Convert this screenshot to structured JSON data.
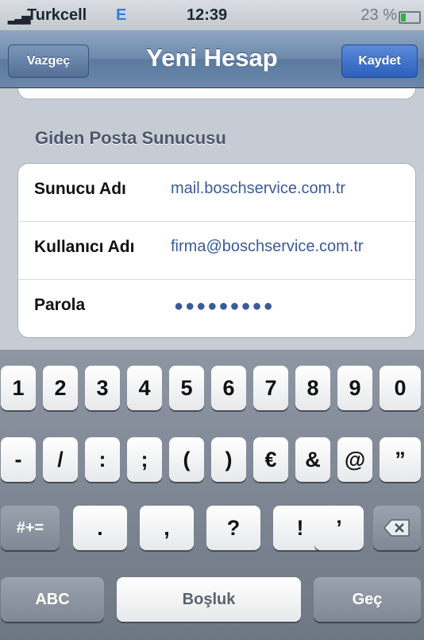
{
  "status": {
    "carrier": "Turkcell",
    "network": "E",
    "time": "12:39",
    "battery": "23 %"
  },
  "nav": {
    "cancel": "Vazgeç",
    "title": "Yeni Hesap",
    "save": "Kaydet"
  },
  "section": "Giden Posta Sunucusu",
  "rows": [
    {
      "label": "Sunucu Adı",
      "value": "mail.boschservice.com.tr"
    },
    {
      "label": "Kullanıcı Adı",
      "value": "firma@boschservice.com.tr"
    },
    {
      "label": "Parola",
      "value": "●●●●●●●●●"
    }
  ],
  "keyboard": {
    "row1": [
      "1",
      "2",
      "3",
      "4",
      "5",
      "6",
      "7",
      "8",
      "9",
      "0"
    ],
    "row2": [
      "-",
      "/",
      ":",
      ";",
      "(",
      ")",
      "€",
      "&",
      "@",
      "”"
    ],
    "row3": {
      "shift": "#+=",
      "keys": [
        ".",
        ",",
        "?",
        "!",
        "’"
      ],
      "delete_icon": "delete-key-icon"
    },
    "row4": {
      "abc": "ABC",
      "space": "Boşluk",
      "go": "Geç"
    }
  }
}
